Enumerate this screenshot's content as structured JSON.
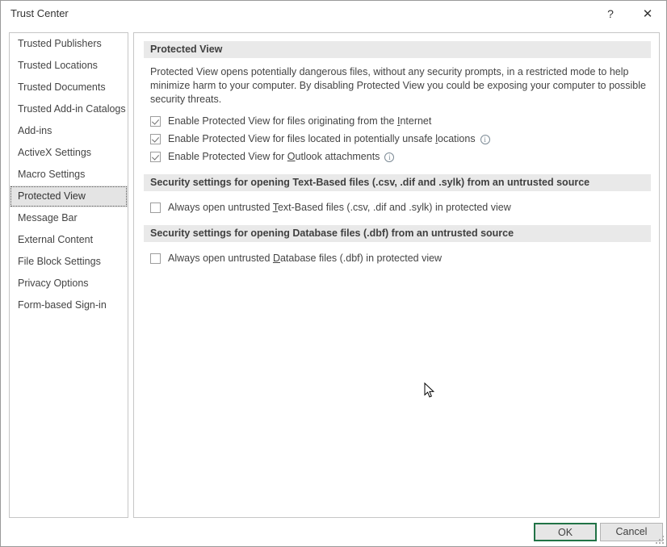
{
  "window": {
    "title": "Trust Center",
    "help_label": "?",
    "close_label": "✕"
  },
  "sidebar": {
    "items": [
      {
        "label": "Trusted Publishers",
        "selected": false
      },
      {
        "label": "Trusted Locations",
        "selected": false
      },
      {
        "label": "Trusted Documents",
        "selected": false
      },
      {
        "label": "Trusted Add-in Catalogs",
        "selected": false
      },
      {
        "label": "Add-ins",
        "selected": false
      },
      {
        "label": "ActiveX Settings",
        "selected": false
      },
      {
        "label": "Macro Settings",
        "selected": false
      },
      {
        "label": "Protected View",
        "selected": true
      },
      {
        "label": "Message Bar",
        "selected": false
      },
      {
        "label": "External Content",
        "selected": false
      },
      {
        "label": "File Block Settings",
        "selected": false
      },
      {
        "label": "Privacy Options",
        "selected": false
      },
      {
        "label": "Form-based Sign-in",
        "selected": false
      }
    ]
  },
  "main": {
    "section1_title": "Protected View",
    "description": "Protected View opens potentially dangerous files, without any security prompts, in a restricted mode to help minimize harm to your computer. By disabling Protected View you could be exposing your computer to possible security threats.",
    "checkboxes_protected_view": [
      {
        "label_before": "Enable Protected View for files originating from the ",
        "accel": "I",
        "label_after": "nternet",
        "checked": true,
        "info": false
      },
      {
        "label_before": "Enable Protected View for files located in potentially unsafe ",
        "accel": "l",
        "label_after": "ocations",
        "checked": true,
        "info": true
      },
      {
        "label_before": "Enable Protected View for ",
        "accel": "O",
        "label_after": "utlook attachments",
        "checked": true,
        "info": true
      }
    ],
    "section2_title": "Security settings for opening Text-Based files (.csv, .dif and .sylk) from an untrusted source",
    "checkbox_text_based": {
      "label_before": "Always open untrusted ",
      "accel": "T",
      "label_after": "ext-Based files (.csv, .dif and .sylk) in protected view",
      "checked": false,
      "info": false
    },
    "section3_title": "Security settings for opening Database files (.dbf) from an untrusted source",
    "checkbox_database": {
      "label_before": "Always open untrusted ",
      "accel": "D",
      "label_after": "atabase files (.dbf) in protected view",
      "checked": false,
      "info": false
    },
    "info_icon_glyph": "i"
  },
  "footer": {
    "ok_label": "OK",
    "cancel_label": "Cancel"
  },
  "colors": {
    "accent_green": "#217346",
    "section_band": "#e9e9e9",
    "selection": "#e4e4e4",
    "text": "#444444",
    "info_icon": "#7c8a95"
  }
}
